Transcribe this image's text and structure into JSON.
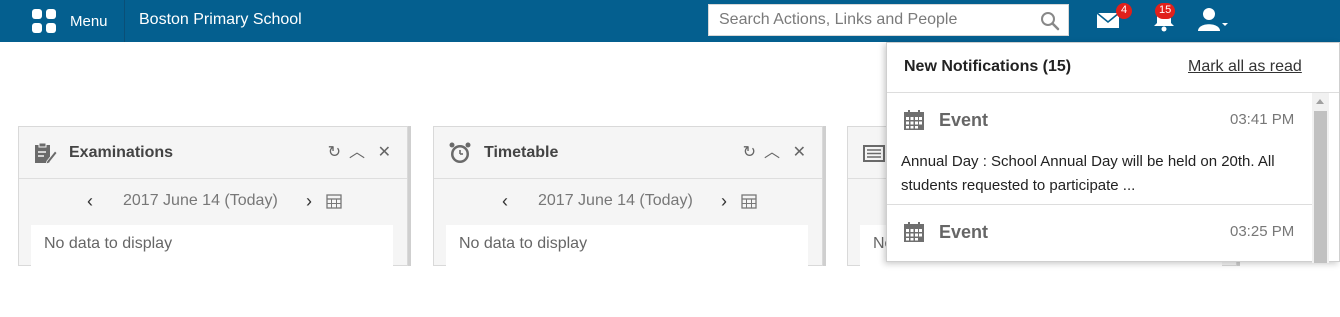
{
  "topbar": {
    "menu_label": "Menu",
    "school_name": "Boston Primary School",
    "search_placeholder": "Search Actions, Links and People",
    "mail_count": "4",
    "notification_count": "15",
    "icons": [
      "menu-grid-icon",
      "search-icon",
      "mail-icon",
      "bell-icon",
      "user-icon"
    ],
    "colors": {
      "bar": "#045f8f",
      "badge": "#e0201b"
    }
  },
  "widgets": [
    {
      "title": "Examinations",
      "icon": "exam-icon",
      "date": "2017 June 14 (Today)",
      "body": "No data to display"
    },
    {
      "title": "Timetable",
      "icon": "clock-icon",
      "date": "2017 June 14 (Today)",
      "body": "No data to display"
    },
    {
      "title": "",
      "icon": "news-icon",
      "date": "",
      "body": "No data to display"
    }
  ],
  "notifications": {
    "title": "New Notifications (15)",
    "mark_all": "Mark all as read",
    "items": [
      {
        "type": "Event",
        "time": "03:41 PM",
        "text": "Annual Day : School Annual Day will be held on 20th. All students requested to participate ..."
      },
      {
        "type": "Event",
        "time": "03:25 PM",
        "text": ""
      }
    ]
  }
}
